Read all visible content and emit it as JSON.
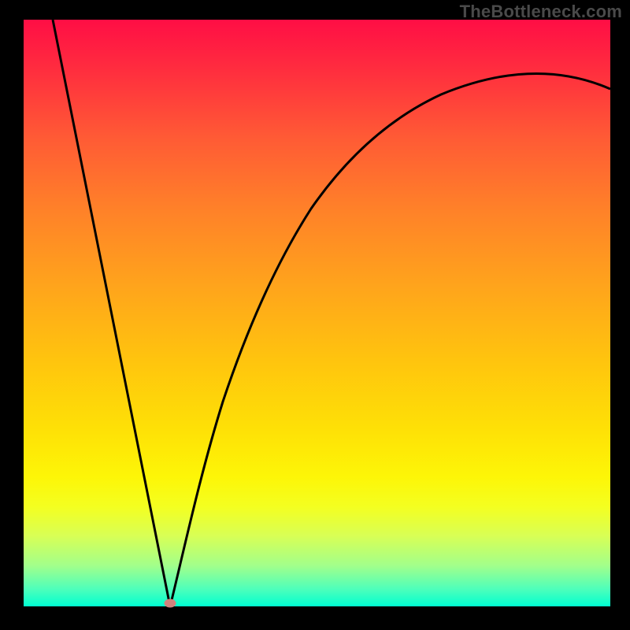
{
  "watermark": "TheBottleneck.com",
  "chart_data": {
    "type": "line",
    "title": "",
    "xlabel": "",
    "ylabel": "",
    "xlim": [
      0,
      100
    ],
    "ylim": [
      0,
      100
    ],
    "grid": false,
    "legend": false,
    "series": [
      {
        "name": "left-branch",
        "x": [
          5,
          8,
          12,
          16,
          20,
          23,
          25
        ],
        "values": [
          100,
          87,
          70,
          52,
          34,
          17,
          0
        ]
      },
      {
        "name": "right-branch",
        "x": [
          25,
          27,
          30,
          34,
          38,
          42,
          47,
          53,
          60,
          68,
          77,
          88,
          100
        ],
        "values": [
          0,
          10,
          22,
          34,
          44,
          52,
          60,
          67,
          73,
          78,
          82,
          85,
          88
        ]
      }
    ],
    "marker": {
      "x": 25,
      "y": 0
    }
  },
  "colors": {
    "curve": "#000000",
    "point": "#d1827d",
    "frame": "#000000"
  }
}
